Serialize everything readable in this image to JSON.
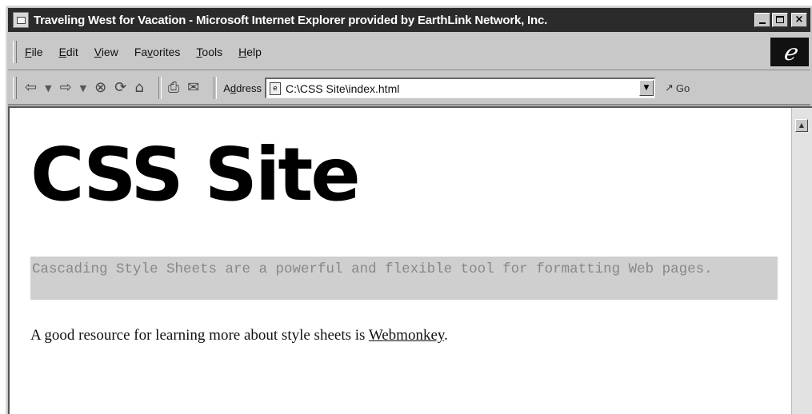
{
  "window": {
    "title": "Traveling West for Vacation - Microsoft Internet Explorer provided by EarthLink Network, Inc.",
    "close_glyph": "×"
  },
  "menu": {
    "items": [
      {
        "first": "F",
        "rest": "ile"
      },
      {
        "first": "E",
        "rest": "dit"
      },
      {
        "first": "V",
        "rest": "iew"
      },
      {
        "first": "Fa",
        "under": "v",
        "rest": "orites"
      },
      {
        "first": "T",
        "rest": "ools"
      },
      {
        "first": "H",
        "rest": "elp"
      }
    ]
  },
  "toolbar": {
    "address_label_pre": "A",
    "address_label_under": "d",
    "address_label_post": "dress",
    "address_value": "C:\\CSS Site\\index.html",
    "go_label": "Go"
  },
  "page": {
    "heading": "CSS Site",
    "intro": "Cascading Style Sheets are a powerful and flexible tool for formatting Web pages.",
    "body_text": "A good resource for learning more about style sheets is ",
    "link_text": "Webmonkey",
    "body_end": "."
  },
  "icons": {
    "logo": "ie-logo",
    "back": "back-arrow-icon",
    "forward": "forward-arrow-icon",
    "stop": "stop-icon",
    "refresh": "refresh-icon",
    "home": "home-icon",
    "print": "print-icon",
    "mail": "mail-icon"
  }
}
